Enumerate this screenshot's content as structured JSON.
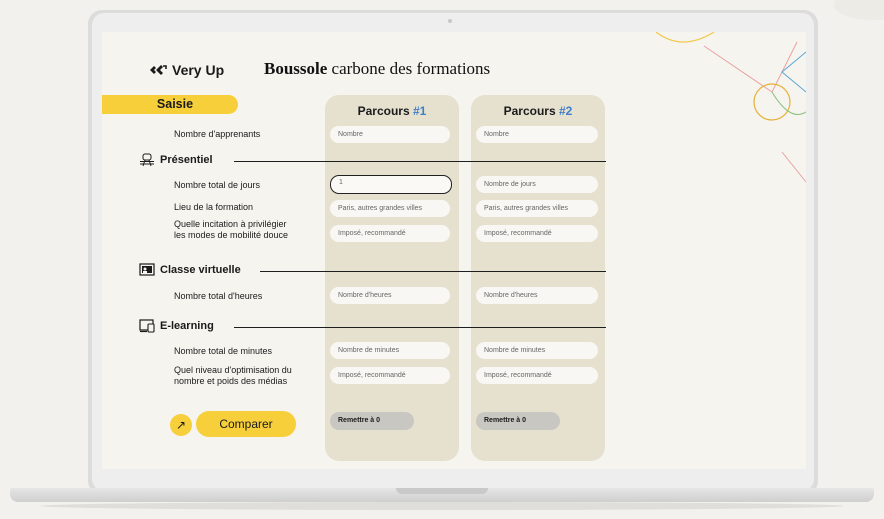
{
  "app": {
    "brand": "Very Up",
    "title_bold": "Boussole",
    "title_rest": " carbone des formations"
  },
  "tab_saisie": "Saisie",
  "columns": [
    {
      "label": "Parcours",
      "num": "#1"
    },
    {
      "label": "Parcours",
      "num": "#2"
    }
  ],
  "labels": {
    "apprenants": "Nombre d'apprenants",
    "jours": "Nombre total de jours",
    "lieu": "Lieu de la formation",
    "incitation_1": "Quelle incitation à privilégier",
    "incitation_2": "les modes de mobilité douce",
    "heures": "Nombre total d'heures",
    "minutes": "Nombre total de minutes",
    "optim_1": "Quel niveau d'optimisation du",
    "optim_2": "nombre et poids des médias"
  },
  "sections": {
    "presentiel": "Présentiel",
    "classe_virtuelle": "Classe virtuelle",
    "elearning": "E-learning"
  },
  "parcours1": {
    "apprenants": "Nombre",
    "jours_value": "1",
    "lieu": "Paris, autres grandes villes",
    "incitation": "Imposé, recommandé",
    "heures": "Nombre d'heures",
    "minutes": "Nombre de minutes",
    "optim": "Imposé, recommandé",
    "reset": "Remettre à 0"
  },
  "parcours2": {
    "apprenants": "Nombre",
    "jours": "Nombre de jours",
    "lieu": "Paris, autres grandes villes",
    "incitation": "Imposé, recommandé",
    "heures": "Nombre d'heures",
    "minutes": "Nombre de minutes",
    "optim": "Imposé, recommandé",
    "reset": "Remettre à 0"
  },
  "compare_button": "Comparer",
  "colors": {
    "accent_yellow": "#f6cf3a",
    "accent_blue": "#3f7ec9",
    "column_bg": "#e6e0cf"
  }
}
